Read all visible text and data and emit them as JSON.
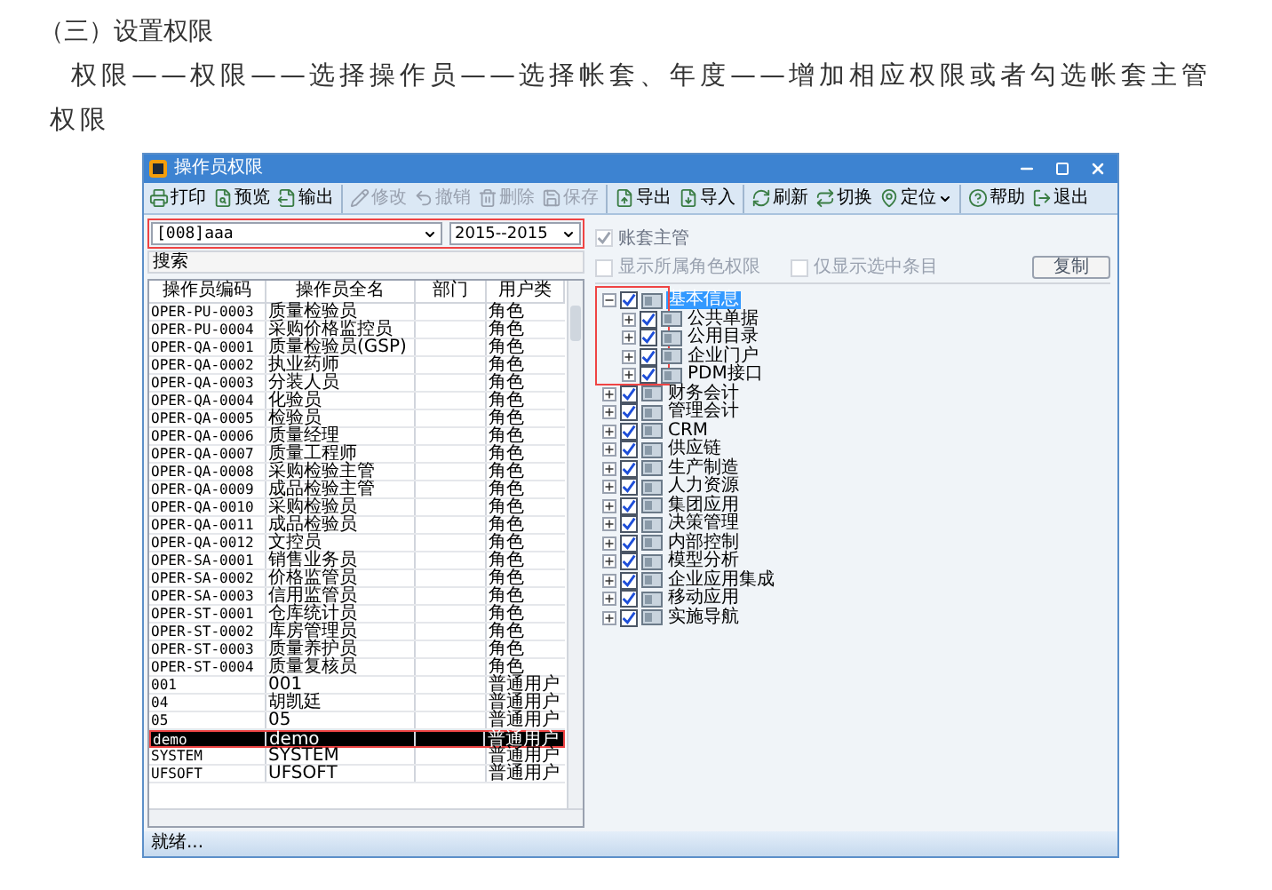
{
  "article": {
    "heading": "（三）设置权限",
    "paragraph": "权限——权限——选择操作员——选择帐套、年度——增加相应权限或者勾选帐套主管权限"
  },
  "window": {
    "title": "操作员权限",
    "toolbar": [
      {
        "buttons": [
          {
            "label": "打印",
            "kind": "button",
            "disabled": false
          },
          {
            "label": "预览",
            "kind": "button",
            "disabled": false
          },
          {
            "label": "输出",
            "kind": "button",
            "disabled": false
          }
        ]
      },
      {
        "buttons": [
          {
            "label": "修改",
            "kind": "button",
            "disabled": true
          },
          {
            "label": "撤销",
            "kind": "button",
            "disabled": true
          },
          {
            "label": "删除",
            "kind": "button",
            "disabled": true
          },
          {
            "label": "保存",
            "kind": "button",
            "disabled": true
          }
        ]
      },
      {
        "buttons": [
          {
            "label": "导出",
            "kind": "button",
            "disabled": false
          },
          {
            "label": "导入",
            "kind": "button",
            "disabled": false
          }
        ]
      },
      {
        "buttons": [
          {
            "label": "刷新",
            "kind": "button",
            "disabled": false
          },
          {
            "label": "切换",
            "kind": "button",
            "disabled": false
          },
          {
            "label": "定位",
            "kind": "dropdown",
            "disabled": false
          }
        ]
      },
      {
        "buttons": [
          {
            "label": "帮助",
            "kind": "button",
            "disabled": false
          },
          {
            "label": "退出",
            "kind": "button",
            "disabled": false
          }
        ]
      }
    ],
    "filters": {
      "account": "[008]aaa",
      "year": "2015--2015",
      "highlighted": true
    },
    "search": {
      "value": "搜索"
    },
    "table": {
      "columns": [
        "操作员编码",
        "操作员全名",
        "部门",
        "用户类"
      ],
      "rows": [
        {
          "code": "OPER-PU-0003",
          "name": "质量检验员",
          "type": "角色",
          "selected": false,
          "highlighted": false
        },
        {
          "code": "OPER-PU-0004",
          "name": "采购价格监控员",
          "type": "角色",
          "selected": false,
          "highlighted": false
        },
        {
          "code": "OPER-QA-0001",
          "name": "质量检验员(GSP)",
          "type": "角色",
          "selected": false,
          "highlighted": false
        },
        {
          "code": "OPER-QA-0002",
          "name": "执业药师",
          "type": "角色",
          "selected": false,
          "highlighted": false
        },
        {
          "code": "OPER-QA-0003",
          "name": "分装人员",
          "type": "角色",
          "selected": false,
          "highlighted": false
        },
        {
          "code": "OPER-QA-0004",
          "name": "化验员",
          "type": "角色",
          "selected": false,
          "highlighted": false
        },
        {
          "code": "OPER-QA-0005",
          "name": "检验员",
          "type": "角色",
          "selected": false,
          "highlighted": false
        },
        {
          "code": "OPER-QA-0006",
          "name": "质量经理",
          "type": "角色",
          "selected": false,
          "highlighted": false
        },
        {
          "code": "OPER-QA-0007",
          "name": "质量工程师",
          "type": "角色",
          "selected": false,
          "highlighted": false
        },
        {
          "code": "OPER-QA-0008",
          "name": "采购检验主管",
          "type": "角色",
          "selected": false,
          "highlighted": false
        },
        {
          "code": "OPER-QA-0009",
          "name": "成品检验主管",
          "type": "角色",
          "selected": false,
          "highlighted": false
        },
        {
          "code": "OPER-QA-0010",
          "name": "采购检验员",
          "type": "角色",
          "selected": false,
          "highlighted": false
        },
        {
          "code": "OPER-QA-0011",
          "name": "成品检验员",
          "type": "角色",
          "selected": false,
          "highlighted": false
        },
        {
          "code": "OPER-QA-0012",
          "name": "文控员",
          "type": "角色",
          "selected": false,
          "highlighted": false
        },
        {
          "code": "OPER-SA-0001",
          "name": "销售业务员",
          "type": "角色",
          "selected": false,
          "highlighted": false
        },
        {
          "code": "OPER-SA-0002",
          "name": "价格监管员",
          "type": "角色",
          "selected": false,
          "highlighted": false
        },
        {
          "code": "OPER-SA-0003",
          "name": "信用监管员",
          "type": "角色",
          "selected": false,
          "highlighted": false
        },
        {
          "code": "OPER-ST-0001",
          "name": "仓库统计员",
          "type": "角色",
          "selected": false,
          "highlighted": false
        },
        {
          "code": "OPER-ST-0002",
          "name": "库房管理员",
          "type": "角色",
          "selected": false,
          "highlighted": false
        },
        {
          "code": "OPER-ST-0003",
          "name": "质量养护员",
          "type": "角色",
          "selected": false,
          "highlighted": false
        },
        {
          "code": "OPER-ST-0004",
          "name": "质量复核员",
          "type": "角色",
          "selected": false,
          "highlighted": false
        },
        {
          "code": "001",
          "name": "001",
          "type": "普通用户",
          "selected": false,
          "highlighted": false
        },
        {
          "code": "04",
          "name": "胡凯廷",
          "type": "普通用户",
          "selected": false,
          "highlighted": false
        },
        {
          "code": "05",
          "name": "05",
          "type": "普通用户",
          "selected": false,
          "highlighted": false
        },
        {
          "code": "demo",
          "name": "demo",
          "type": "普通用户",
          "selected": true,
          "highlighted": true
        },
        {
          "code": "SYSTEM",
          "name": "SYSTEM",
          "type": "普通用户",
          "selected": false,
          "highlighted": false
        },
        {
          "code": "UFSOFT",
          "name": "UFSOFT",
          "type": "普通用户",
          "selected": false,
          "highlighted": false
        }
      ]
    },
    "options": [
      {
        "label": "账套主管",
        "checked": true,
        "disabled": true
      },
      {
        "label": "显示所属角色权限",
        "checked": false,
        "disabled": true
      },
      {
        "label": "仅显示选中条目",
        "checked": false,
        "disabled": true
      }
    ],
    "copy_button": "复制",
    "tree": [
      {
        "label": "基本信息",
        "expanded": true,
        "checked": true,
        "selected": true,
        "highlighted": true,
        "children": [
          {
            "label": "公共单据",
            "expanded": false,
            "checked": true,
            "selected": false,
            "highlighted": false
          },
          {
            "label": "公用目录",
            "expanded": false,
            "checked": true,
            "selected": false,
            "highlighted": false
          },
          {
            "label": "企业门户",
            "expanded": false,
            "checked": true,
            "selected": false,
            "highlighted": false
          },
          {
            "label": "PDM接口",
            "expanded": false,
            "checked": true,
            "selected": false,
            "highlighted": false
          }
        ]
      },
      {
        "label": "财务会计",
        "expanded": false,
        "checked": true,
        "selected": false,
        "highlighted": false
      },
      {
        "label": "管理会计",
        "expanded": false,
        "checked": true,
        "selected": false,
        "highlighted": false
      },
      {
        "label": "CRM",
        "expanded": false,
        "checked": true,
        "selected": false,
        "highlighted": false
      },
      {
        "label": "供应链",
        "expanded": false,
        "checked": true,
        "selected": false,
        "highlighted": false
      },
      {
        "label": "生产制造",
        "expanded": false,
        "checked": true,
        "selected": false,
        "highlighted": false
      },
      {
        "label": "人力资源",
        "expanded": false,
        "checked": true,
        "selected": false,
        "highlighted": false
      },
      {
        "label": "集团应用",
        "expanded": false,
        "checked": true,
        "selected": false,
        "highlighted": false
      },
      {
        "label": "决策管理",
        "expanded": false,
        "checked": true,
        "selected": false,
        "highlighted": false
      },
      {
        "label": "内部控制",
        "expanded": false,
        "checked": true,
        "selected": false,
        "highlighted": false
      },
      {
        "label": "模型分析",
        "expanded": false,
        "checked": true,
        "selected": false,
        "highlighted": false
      },
      {
        "label": "企业应用集成",
        "expanded": false,
        "checked": true,
        "selected": false,
        "highlighted": false
      },
      {
        "label": "移动应用",
        "expanded": false,
        "checked": true,
        "selected": false,
        "highlighted": false
      },
      {
        "label": "实施导航",
        "expanded": false,
        "checked": true,
        "selected": false,
        "highlighted": false
      }
    ],
    "status_bar": "就绪..."
  }
}
